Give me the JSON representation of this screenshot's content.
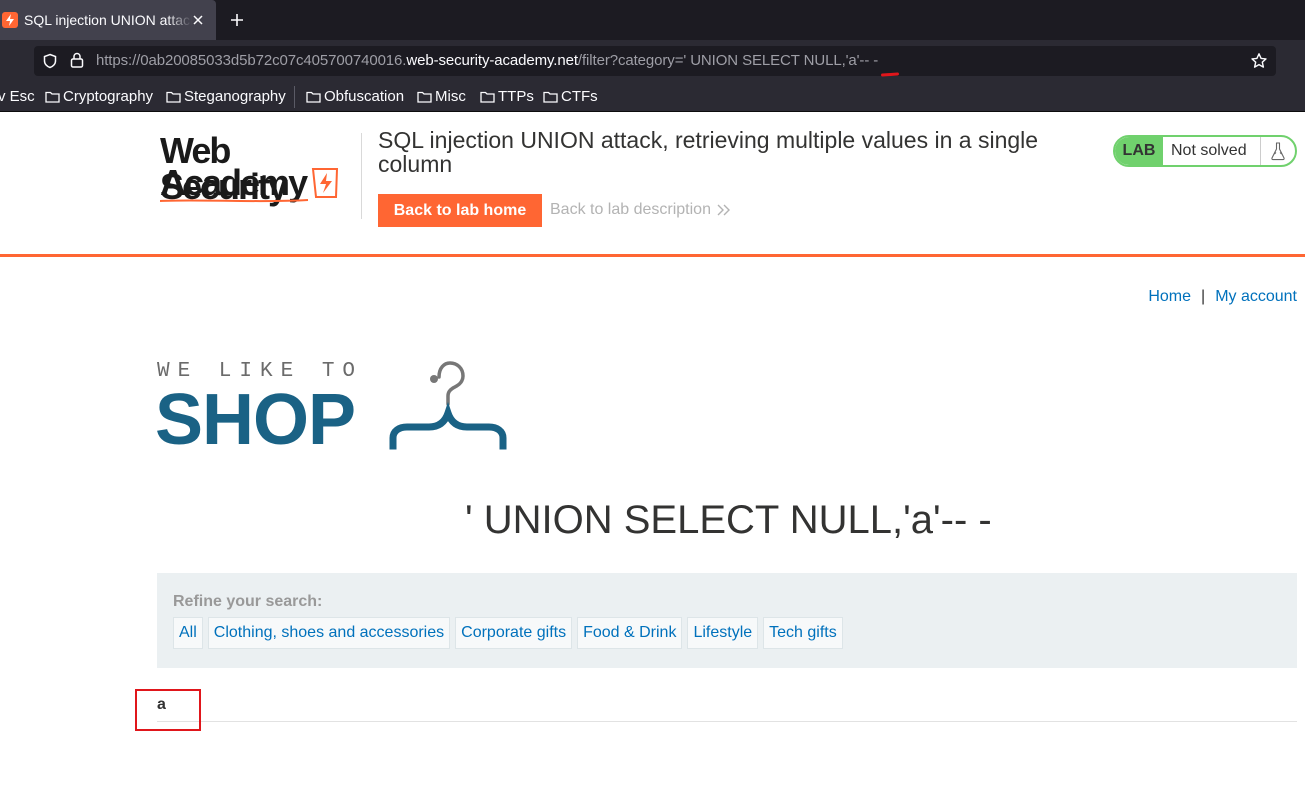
{
  "browser": {
    "tab_title": "SQL injection UNION attack, retrieving multiple values in a single column",
    "url_prefix": "https://0ab20085033d5b72c07c405700740016.",
    "url_domain": "web-security-academy.net",
    "url_path": "/filter?category=' UNION SELECT NULL,'a'-- -",
    "bookmarks": [
      "v Esc",
      "Cryptography",
      "Steganography",
      "Obfuscation",
      "Misc",
      "TTPs",
      "CTFs"
    ]
  },
  "lab": {
    "logo_line1": "Web Security",
    "logo_line2": "Academy",
    "title": "SQL injection UNION attack, retrieving multiple values in a single column",
    "back_home": "Back to lab home",
    "back_description": "Back to lab description",
    "badge": "LAB",
    "status": "Not solved"
  },
  "nav": {
    "home": "Home",
    "separator": "|",
    "my_account": "My account"
  },
  "shop_logo": {
    "tagline": "WE LIKE TO",
    "name": "SHOP"
  },
  "search_heading": "' UNION SELECT NULL,'a'-- -",
  "filters": {
    "label": "Refine your search:",
    "items": [
      "All",
      "Clothing, shoes and accessories",
      "Corporate gifts",
      "Food & Drink",
      "Lifestyle",
      "Tech gifts"
    ]
  },
  "results": [
    {
      "value": "a"
    }
  ],
  "colors": {
    "accent": "#ff6633",
    "link": "#0071bc",
    "lab_badge": "#70d16d",
    "shop_logo": "#1a6285",
    "highlight": "#e0161b"
  }
}
